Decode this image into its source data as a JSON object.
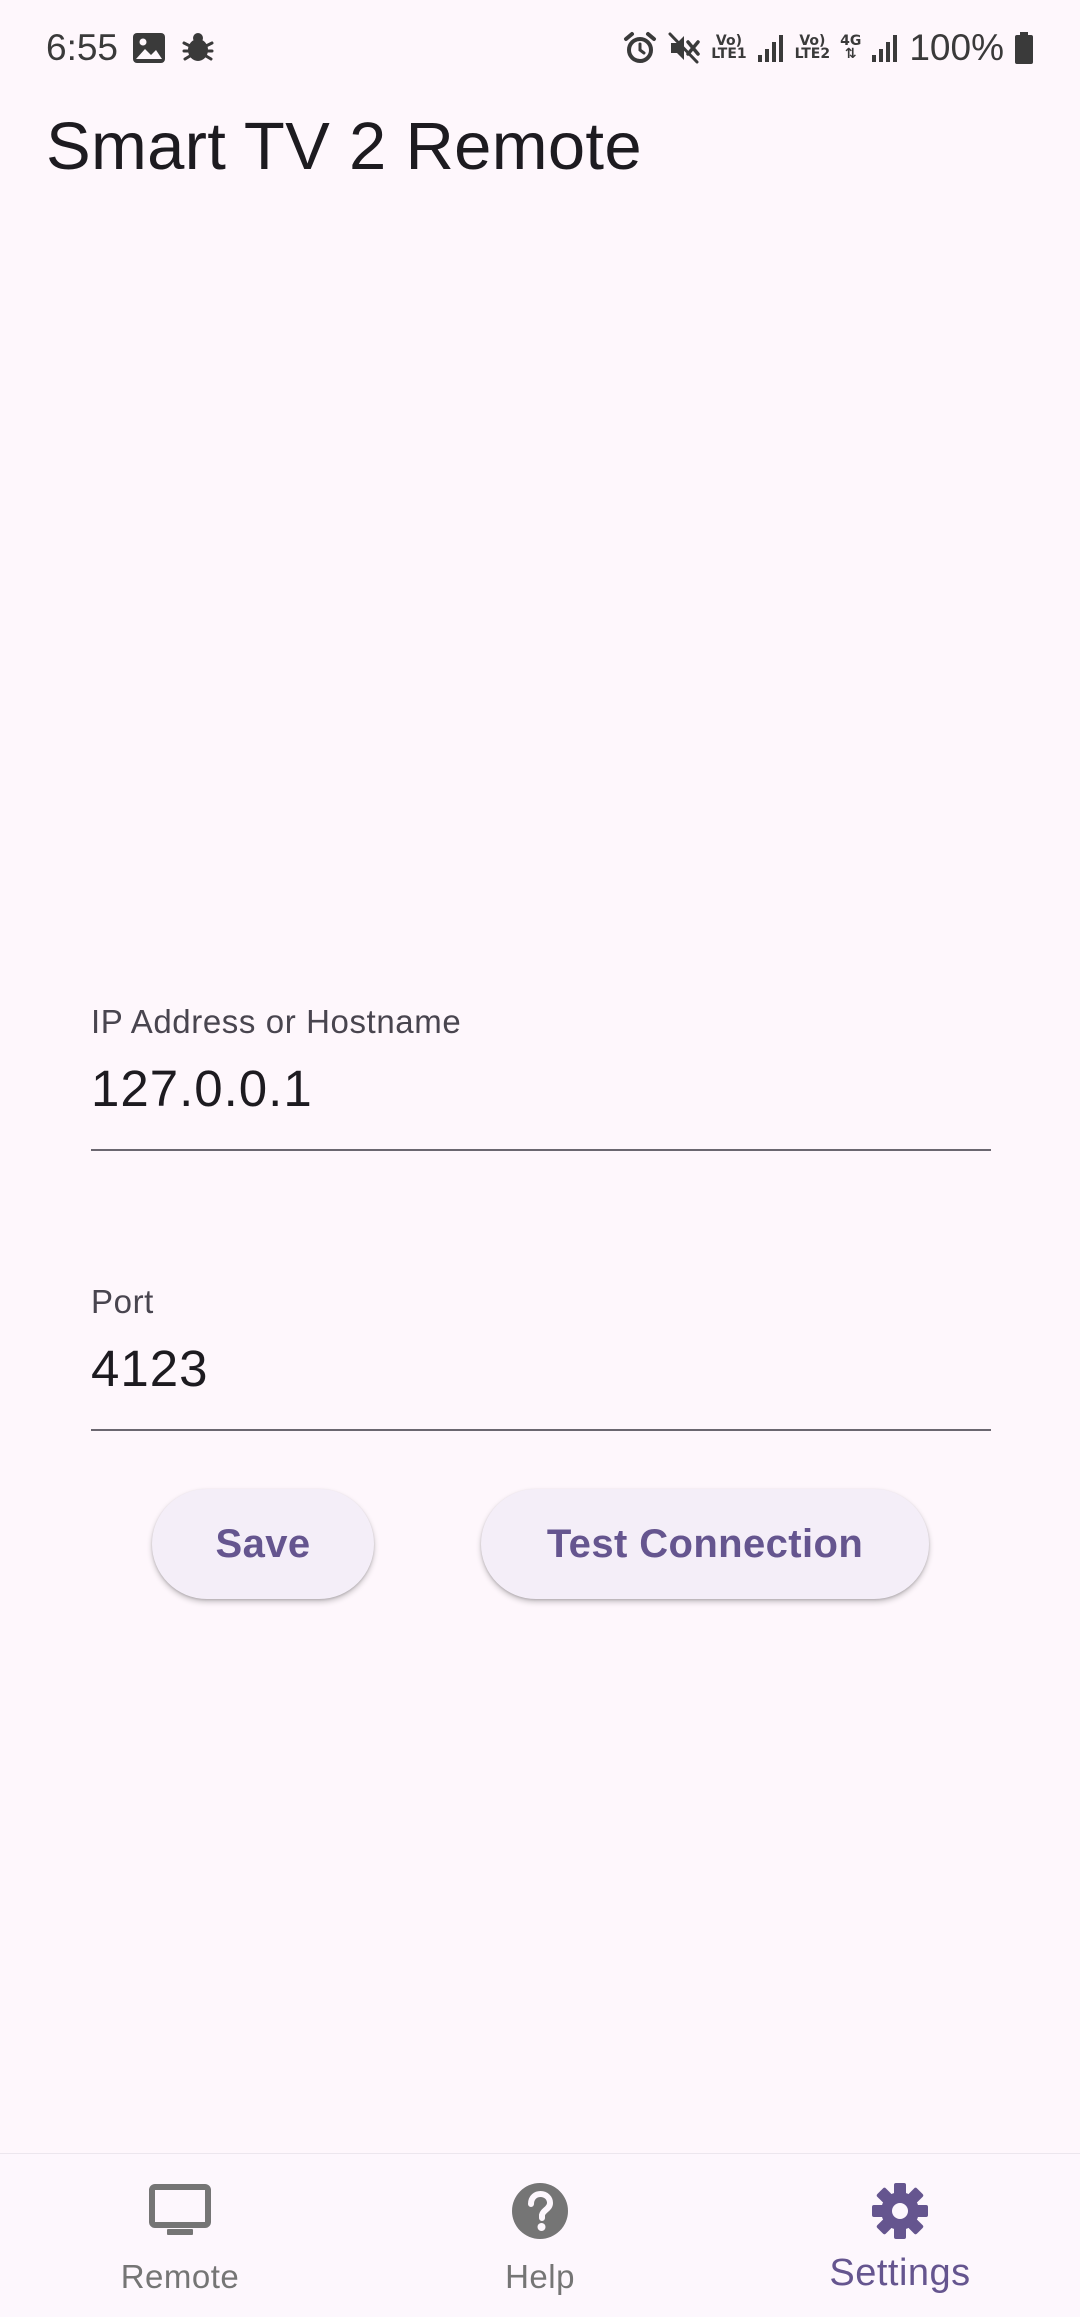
{
  "status_bar": {
    "time": "6:55",
    "volte1_top": "Vo)",
    "volte1_bottom": "LTE1",
    "volte2_top": "Vo)",
    "volte2_bottom": "LTE2",
    "network_type": "4G",
    "battery": "100%"
  },
  "app": {
    "title": "Smart TV 2 Remote"
  },
  "form": {
    "ip_label": "IP Address or Hostname",
    "ip_value": "127.0.0.1",
    "port_label": "Port",
    "port_value": "4123"
  },
  "actions": {
    "save_label": "Save",
    "test_label": "Test Connection"
  },
  "nav": {
    "items": [
      {
        "label": "Remote",
        "icon": "tv-icon",
        "active": false
      },
      {
        "label": "Help",
        "icon": "help-icon",
        "active": false
      },
      {
        "label": "Settings",
        "icon": "gear-icon",
        "active": true
      }
    ]
  },
  "colors": {
    "background": "#fef7fc",
    "accent": "#65558f",
    "button_bg": "#f4eef8",
    "inactive": "#757575"
  }
}
